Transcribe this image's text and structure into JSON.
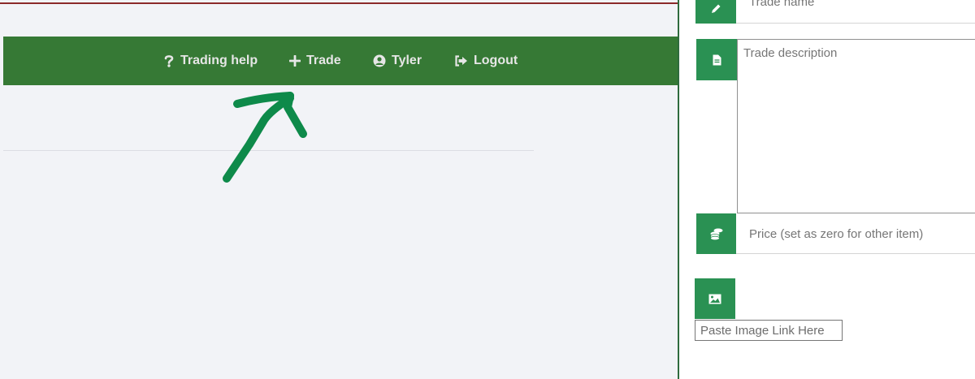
{
  "colors": {
    "navbar": "#367935",
    "addon": "#2a9153",
    "annotation_arrow": "#0e8a4a",
    "page_background": "#f2f3f7",
    "top_rule": "#8b2a2a"
  },
  "nav": {
    "items": [
      {
        "label": "Trading help",
        "icon": "question-icon"
      },
      {
        "label": "Trade",
        "icon": "plus-icon"
      },
      {
        "label": "Tyler",
        "icon": "user-circle-icon"
      },
      {
        "label": "Logout",
        "icon": "sign-out-icon"
      }
    ]
  },
  "annotation": {
    "icon": "hand-drawn-arrow-icon"
  },
  "form": {
    "trade_name": {
      "placeholder": "Trade name",
      "icon": "pencil-icon"
    },
    "description": {
      "placeholder": "Trade description",
      "icon": "file-icon"
    },
    "price": {
      "placeholder": "Price (set as zero for other item)",
      "icon": "coins-icon"
    },
    "image": {
      "placeholder": "Paste Image Link Here",
      "icon": "image-icon"
    }
  }
}
